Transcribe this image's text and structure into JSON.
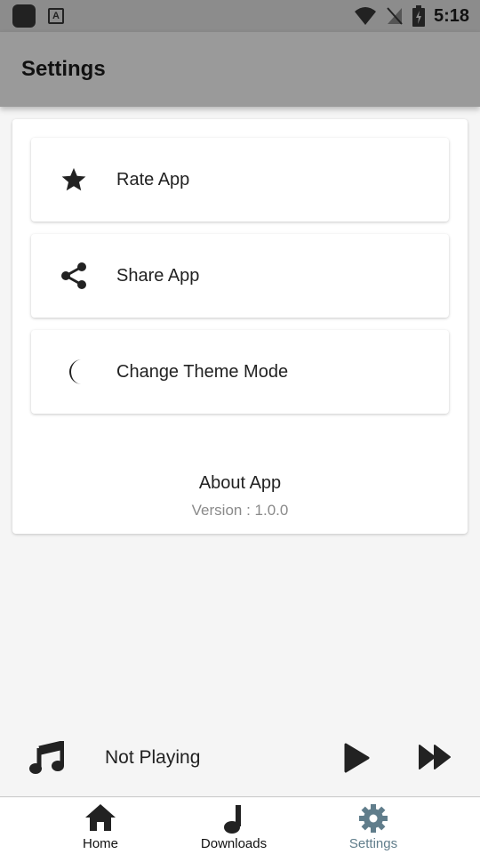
{
  "status_bar": {
    "time": "5:18"
  },
  "app_bar": {
    "title": "Settings"
  },
  "settings": {
    "options": [
      {
        "label": "Rate App",
        "icon": "star-icon"
      },
      {
        "label": "Share App",
        "icon": "share-icon"
      },
      {
        "label": "Change Theme Mode",
        "icon": "moon-icon"
      }
    ],
    "about": {
      "title": "About App",
      "version": "Version : 1.0.0"
    }
  },
  "player": {
    "status": "Not Playing"
  },
  "bottom_nav": {
    "items": [
      {
        "label": "Home",
        "icon": "home-icon"
      },
      {
        "label": "Downloads",
        "icon": "music-note-icon"
      },
      {
        "label": "Settings",
        "icon": "gear-icon",
        "active": true
      }
    ]
  },
  "colors": {
    "app_bar": "#9a9a9a",
    "status_bar": "#8c8c8c",
    "active_nav": "#607d8b"
  }
}
